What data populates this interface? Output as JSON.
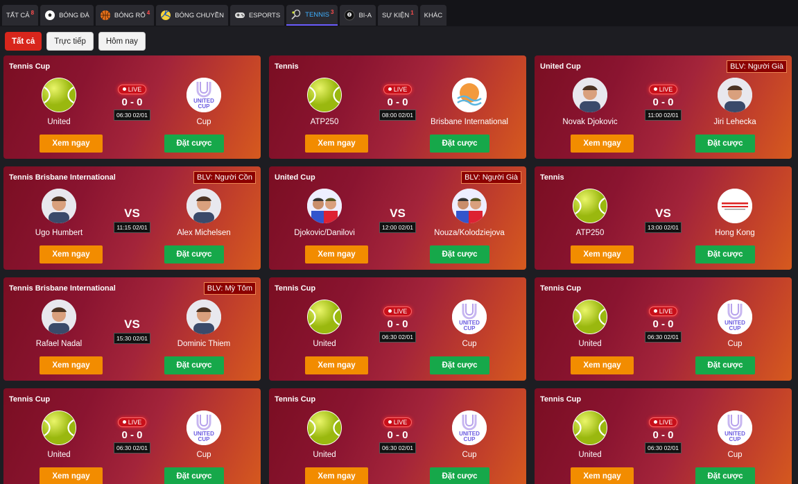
{
  "tabs": [
    {
      "label": "TẤT CẢ",
      "count": "8",
      "icon": ""
    },
    {
      "label": "BÓNG ĐÁ",
      "count": "",
      "icon": "soccer-icon"
    },
    {
      "label": "BÓNG RỔ",
      "count": "4",
      "icon": "basketball-icon"
    },
    {
      "label": "BÓNG CHUYỀN",
      "count": "",
      "icon": "volleyball-icon"
    },
    {
      "label": "ESPORTS",
      "count": "",
      "icon": "gamepad-icon"
    },
    {
      "label": "TENNIS",
      "count": "3",
      "icon": "tennis-racket-icon"
    },
    {
      "label": "BI-A",
      "count": "",
      "icon": "billiard-ball-icon"
    },
    {
      "label": "SỰ KIỆN",
      "count": "1",
      "icon": ""
    },
    {
      "label": "KHÁC",
      "count": "",
      "icon": ""
    }
  ],
  "filters": [
    "Tất cả",
    "Trực tiếp",
    "Hôm nay"
  ],
  "buttons": {
    "watch": "Xem ngay",
    "bet": "Đặt cược"
  },
  "live_label": "LIVE",
  "vs_label": "VS",
  "colors": {
    "accent_red": "#d8261c",
    "watch_orange": "#f28c00",
    "bet_green": "#16a84a",
    "active_tab": "#3fb0ff"
  },
  "matches": [
    {
      "league": "Tennis Cup",
      "blv": "",
      "home": "United",
      "away": "Cup",
      "home_logo": "tennis-ball",
      "away_logo": "united-cup",
      "live": true,
      "score": "0 - 0",
      "time": "06:30 02/01"
    },
    {
      "league": "Tennis",
      "blv": "",
      "home": "ATP250",
      "away": "Brisbane International",
      "home_logo": "tennis-ball",
      "away_logo": "brisbane",
      "live": true,
      "score": "0 - 0",
      "time": "08:00 02/01"
    },
    {
      "league": "United Cup",
      "blv": "BLV: Người Già",
      "home": "Novak Djokovic",
      "away": "Jiri Lehecka",
      "home_logo": "player",
      "away_logo": "player",
      "live": true,
      "score": "0 - 0",
      "time": "11:00 02/01"
    },
    {
      "league": "Tennis Brisbane International",
      "blv": "BLV: Người Cồn",
      "home": "Ugo Humbert",
      "away": "Alex Michelsen",
      "home_logo": "player",
      "away_logo": "player",
      "live": false,
      "score": "",
      "time": "11:15 02/01"
    },
    {
      "league": "United Cup",
      "blv": "BLV: Người Già",
      "home": "Djokovic/Danilovi",
      "away": "Nouza/Kolodziejova",
      "home_logo": "players",
      "away_logo": "players",
      "live": false,
      "score": "",
      "time": "12:00 02/01"
    },
    {
      "league": "Tennis",
      "blv": "",
      "home": "ATP250",
      "away": "Hong Kong",
      "home_logo": "tennis-ball",
      "away_logo": "hongkong",
      "live": false,
      "score": "",
      "time": "13:00 02/01"
    },
    {
      "league": "Tennis Brisbane International",
      "blv": "BLV: Mỳ Tôm",
      "home": "Rafael Nadal",
      "away": "Dominic Thiem",
      "home_logo": "player",
      "away_logo": "player",
      "live": false,
      "score": "",
      "time": "15:30 02/01"
    },
    {
      "league": "Tennis Cup",
      "blv": "",
      "home": "United",
      "away": "Cup",
      "home_logo": "tennis-ball",
      "away_logo": "united-cup",
      "live": true,
      "score": "0 - 0",
      "time": "06:30 02/01"
    },
    {
      "league": "Tennis Cup",
      "blv": "",
      "home": "United",
      "away": "Cup",
      "home_logo": "tennis-ball",
      "away_logo": "united-cup",
      "live": true,
      "score": "0 - 0",
      "time": "06:30 02/01"
    },
    {
      "league": "Tennis Cup",
      "blv": "",
      "home": "United",
      "away": "Cup",
      "home_logo": "tennis-ball",
      "away_logo": "united-cup",
      "live": true,
      "score": "0 - 0",
      "time": "06:30 02/01"
    },
    {
      "league": "Tennis Cup",
      "blv": "",
      "home": "United",
      "away": "Cup",
      "home_logo": "tennis-ball",
      "away_logo": "united-cup",
      "live": true,
      "score": "0 - 0",
      "time": "06:30 02/01"
    },
    {
      "league": "Tennis Cup",
      "blv": "",
      "home": "United",
      "away": "Cup",
      "home_logo": "tennis-ball",
      "away_logo": "united-cup",
      "live": true,
      "score": "0 - 0",
      "time": "06:30 02/01"
    }
  ]
}
